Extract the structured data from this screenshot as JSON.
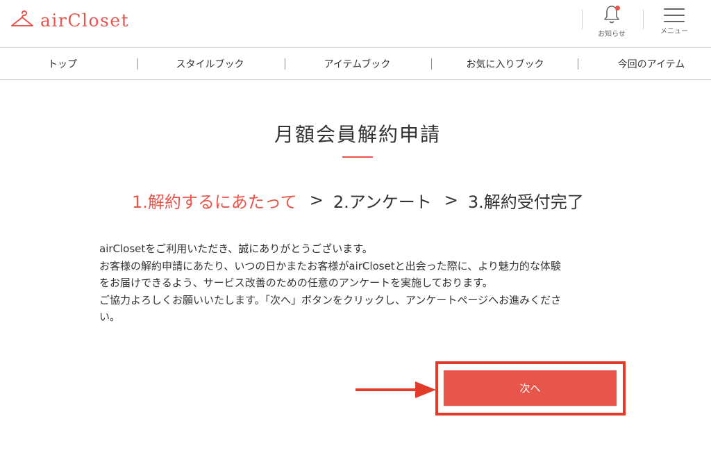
{
  "header": {
    "logo_text": "airCloset",
    "brand_color": "#e8554b",
    "notifications": {
      "label": "お知らせ",
      "icon": "bell-icon",
      "has_badge": true
    },
    "menu": {
      "label": "メニュー",
      "icon": "hamburger-icon"
    }
  },
  "nav": {
    "items": [
      {
        "label": "トップ"
      },
      {
        "label": "スタイルブック"
      },
      {
        "label": "アイテムブック"
      },
      {
        "label": "お気に入りブック"
      },
      {
        "label": "今回のアイテム"
      }
    ]
  },
  "main": {
    "title": "月額会員解約申請",
    "steps": [
      {
        "label": "1.解約するにあたって",
        "active": true
      },
      {
        "label": "2.アンケート",
        "active": false
      },
      {
        "label": "3.解約受付完了",
        "active": false
      }
    ],
    "step_separator": ">",
    "body_lines": [
      "airClosetをご利用いただき、誠にありがとうございます。",
      "お客様の解約申請にあたり、いつの日かまたお客様がairClosetと出会った際に、より魅力的な体験",
      "をお届けできるよう、サービス改善のための任意のアンケートを実施しております。",
      "ご協力よろしくお願いいたします。「次へ」ボタンをクリックし、アンケートページへお進みくださ",
      "い。"
    ],
    "next_button_label": "次へ",
    "annotation_color": "#e33b2a"
  }
}
